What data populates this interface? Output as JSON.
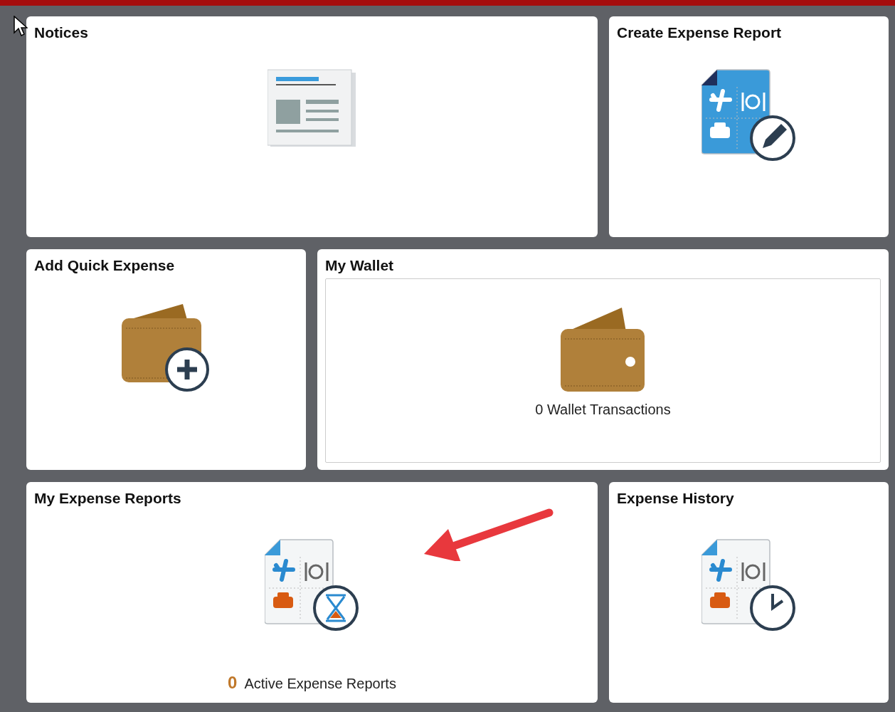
{
  "tiles": [
    {
      "kind": "notices",
      "title": "Notices"
    },
    {
      "kind": "create_report",
      "title": "Create Expense Report"
    },
    {
      "kind": "quick_expense",
      "title": "Add Quick Expense"
    },
    {
      "kind": "wallet",
      "title": "My Wallet",
      "summary": "0 Wallet Transactions"
    },
    {
      "kind": "my_reports",
      "title": "My Expense Reports",
      "count": "0",
      "caption": "Active Expense Reports"
    },
    {
      "kind": "history",
      "title": "Expense History"
    }
  ]
}
